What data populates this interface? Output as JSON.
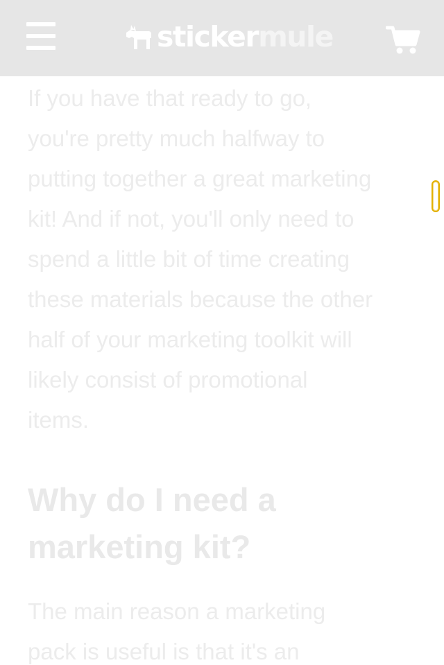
{
  "header": {
    "menu_icon": "hamburger-menu-icon",
    "logo_part1": "sticker",
    "logo_part2": "mule",
    "logo_icon": "mule-icon",
    "cart_icon": "shopping-cart-icon"
  },
  "article": {
    "paragraph1_lines": [
      "If you have that ready to go,",
      "you're pretty much halfway to",
      "putting together a great marketing",
      "kit! And if not, you'll only need to",
      "spend a little bit of time creating",
      "these materials because the other",
      "half of your marketing toolkit will",
      "likely consist of promotional",
      "items."
    ],
    "heading_lines": [
      "Why do I need a",
      "marketing kit?"
    ],
    "paragraph2_lines": [
      "The main reason a marketing",
      "pack is useful is that it's an"
    ]
  },
  "colors": {
    "header_bg": "#e6e6e6",
    "text_faded": "#ececec",
    "scroll_accent": "#e3b000"
  }
}
